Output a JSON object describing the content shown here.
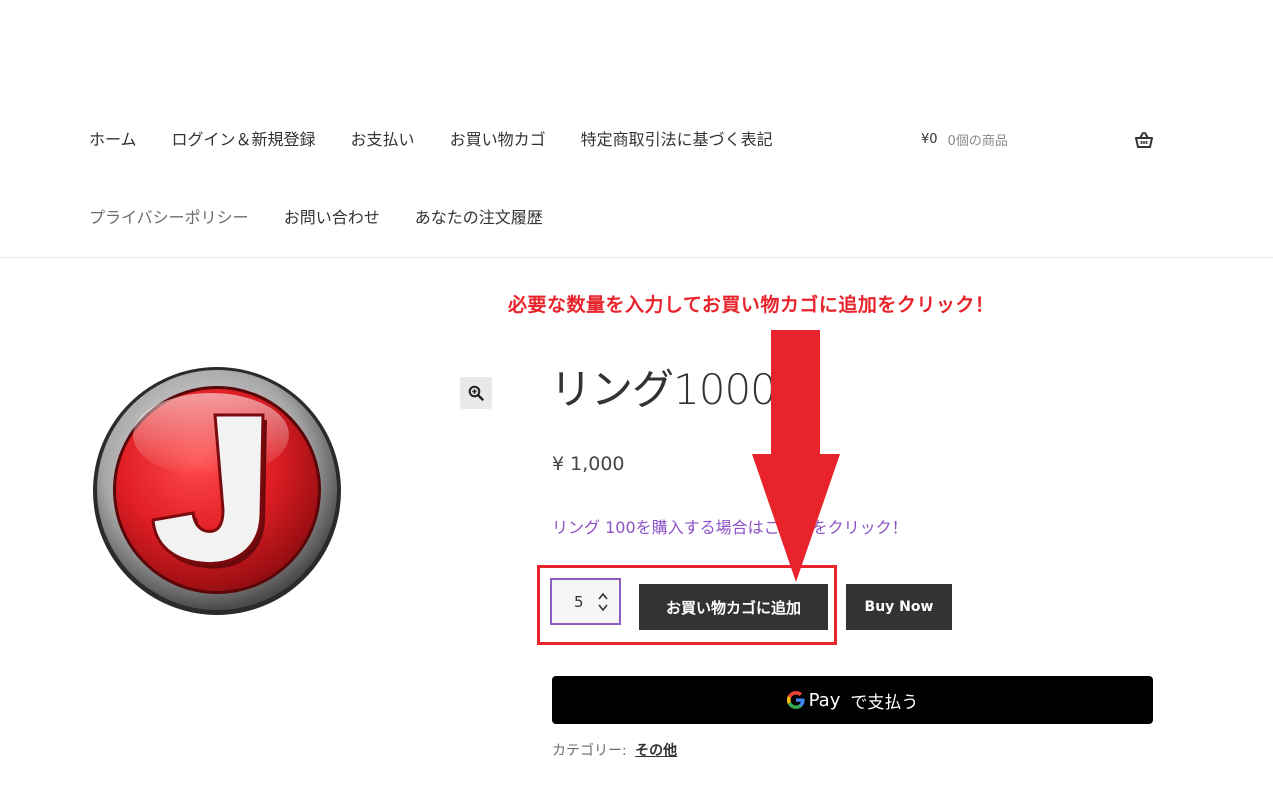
{
  "nav": {
    "row1": [
      "ホーム",
      "ログイン＆新規登録",
      "お支払い",
      "お買い物カゴ",
      "特定商取引法に基づく表記"
    ],
    "row2": [
      "プライバシーポリシー",
      "お問い合わせ",
      "あなたの注文履歴"
    ]
  },
  "cart": {
    "amount": "¥0",
    "count": "0個の商品",
    "icon": "basket-icon"
  },
  "annotation": "必要な数量を入力してお買い物カゴに追加をクリック！",
  "product": {
    "logo_letter": "J",
    "title": "リング1000",
    "price": "¥ 1,000",
    "promo_link": "リング 100を購入する場合はこちらをクリック！",
    "quantity": "5",
    "add_to_cart_label": "お買い物カゴに追加",
    "buy_now_label": "Buy Now",
    "gpay_word": "Pay",
    "gpay_label": "で支払う",
    "category_label": "カテゴリー:",
    "category_value": "その他"
  },
  "colors": {
    "annotation_red": "#e8232b",
    "button_dark": "#333333",
    "link_purple": "#8c52c6",
    "logo_red": "#d81f26"
  }
}
